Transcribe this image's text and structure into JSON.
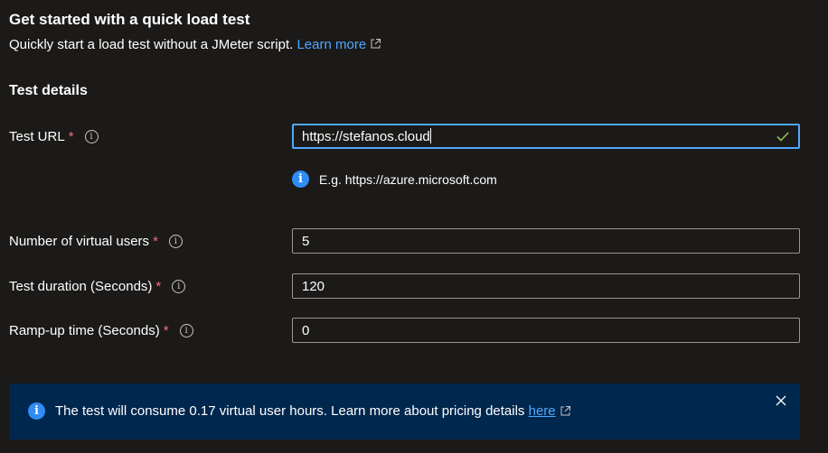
{
  "header": {
    "title": "Get started with a quick load test",
    "subtitle": "Quickly start a load test without a JMeter script.",
    "learn_more": "Learn more"
  },
  "section_title": "Test details",
  "fields": {
    "test_url": {
      "label": "Test URL",
      "required": "*",
      "value": "https://stefanos.cloud",
      "hint": "E.g. https://azure.microsoft.com"
    },
    "virtual_users": {
      "label": "Number of virtual users",
      "required": "*",
      "value": "5"
    },
    "duration": {
      "label": "Test duration (Seconds)",
      "required": "*",
      "value": "120"
    },
    "ramp_up": {
      "label": "Ramp-up time (Seconds)",
      "required": "*",
      "value": "0"
    }
  },
  "banner": {
    "text": "The test will consume 0.17 virtual user hours. Learn more about pricing details",
    "link": "here"
  },
  "icons": {
    "info_outline": "info-icon",
    "info_filled": "info-filled-icon",
    "check": "check-icon",
    "external_link": "external-link-icon",
    "close": "close-icon"
  },
  "colors": {
    "background": "#1b1a19",
    "link": "#4fa8ff",
    "required": "#f1707b",
    "focus_border": "#4fa8ff",
    "valid_check": "#92c353",
    "banner_bg": "#00274d"
  }
}
